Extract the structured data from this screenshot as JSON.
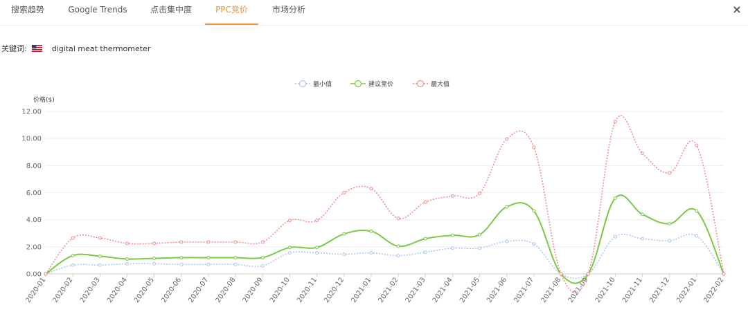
{
  "tabs": [
    {
      "label": "搜索趋势",
      "active": false
    },
    {
      "label": "Google Trends",
      "active": false
    },
    {
      "label": "点击集中度",
      "active": false
    },
    {
      "label": "PPC竞价",
      "active": true
    },
    {
      "label": "市场分析",
      "active": false
    }
  ],
  "close_icon": "×",
  "keyword": {
    "label": "关键词:",
    "flag": "us-flag-icon",
    "term": "digital meat thermometer"
  },
  "colors": {
    "accent": "#f0923c",
    "min": "#a9c6f0",
    "suggested": "#7ac943",
    "max": "#f08a8a"
  },
  "chart_data": {
    "type": "line",
    "ylabel": "价格($)",
    "ylim": [
      0,
      12
    ],
    "yticks": [
      "0.00",
      "2.00",
      "4.00",
      "6.00",
      "8.00",
      "10.00",
      "12.00"
    ],
    "legend_position": "top-center",
    "categories": [
      "2020-01",
      "2020-02",
      "2020-03",
      "2020-04",
      "2020-05",
      "2020-06",
      "2020-07",
      "2020-08",
      "2020-09",
      "2020-10",
      "2020-11",
      "2020-12",
      "2021-01",
      "2021-02",
      "2021-03",
      "2021-04",
      "2021-05",
      "2021-06",
      "2021-07",
      "2021-08",
      "2021-09",
      "2021-10",
      "2021-11",
      "2021-12",
      "2022-01",
      "2022-02"
    ],
    "series": [
      {
        "name": "最小值",
        "style": "dotted",
        "values": [
          0.0,
          0.65,
          0.65,
          0.75,
          0.75,
          0.7,
          0.7,
          0.7,
          0.6,
          1.55,
          1.55,
          1.45,
          1.55,
          1.35,
          1.6,
          1.9,
          1.9,
          2.4,
          2.2,
          0.0,
          0.0,
          2.75,
          2.6,
          2.45,
          2.8,
          0.0
        ]
      },
      {
        "name": "建议竞价",
        "style": "solid",
        "values": [
          0.0,
          1.35,
          1.3,
          1.1,
          1.15,
          1.2,
          1.2,
          1.2,
          1.2,
          1.95,
          1.95,
          2.95,
          3.15,
          2.05,
          2.6,
          2.85,
          2.9,
          4.95,
          4.65,
          0.0,
          0.0,
          5.6,
          4.4,
          3.7,
          4.65,
          0.0
        ]
      },
      {
        "name": "最大值",
        "style": "dotted",
        "values": [
          0.0,
          2.65,
          2.65,
          2.25,
          2.25,
          2.35,
          2.35,
          2.35,
          2.35,
          3.95,
          3.95,
          6.0,
          6.3,
          4.1,
          5.3,
          5.75,
          5.95,
          9.95,
          9.35,
          0.0,
          0.0,
          11.25,
          8.9,
          7.45,
          9.5,
          0.0
        ]
      }
    ]
  }
}
